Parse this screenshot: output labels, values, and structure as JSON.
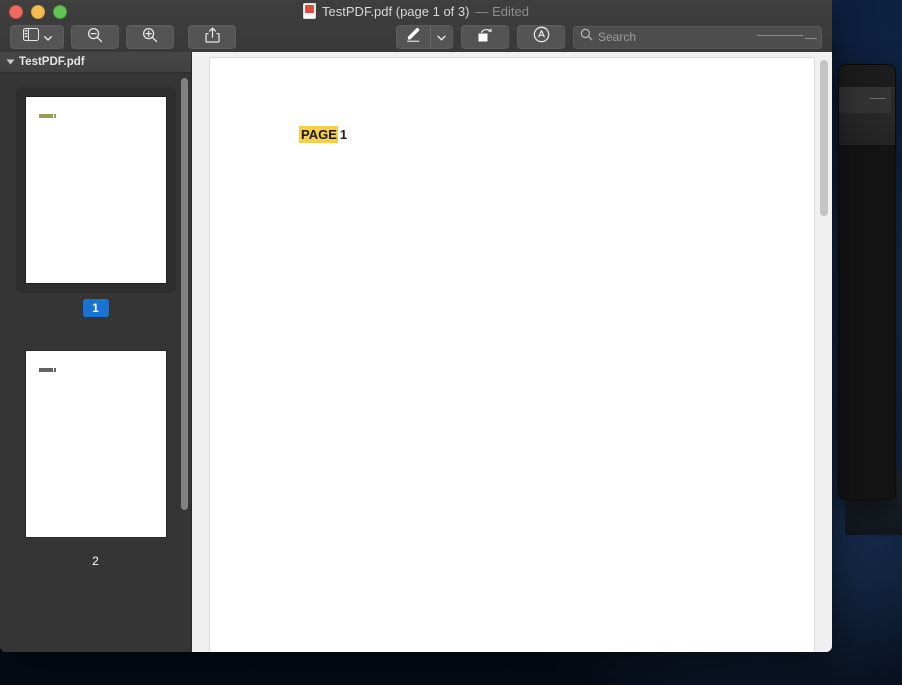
{
  "window": {
    "title_main": "TestPDF.pdf (page 1 of 3)",
    "title_sub": "— Edited",
    "doc_icon": "pdf-document-icon",
    "traffic_lights": {
      "close": "close-window-button",
      "minimize": "minimize-window-button",
      "maximize": "maximize-window-button"
    }
  },
  "toolbar": {
    "sidebar_toggle": "sidebar-toggle-icon",
    "sidebar_chevron": "chevron-down-icon",
    "zoom_out": "zoom-out-icon",
    "zoom_in": "zoom-in-icon",
    "share": "share-icon",
    "markup": "markup-pen-icon",
    "markup_chevron": "chevron-down-icon",
    "rotate": "rotate-icon",
    "annotate": "annotate-icon",
    "search_icon": "search-icon",
    "search_placeholder": "Search",
    "search_value": ""
  },
  "sidebar": {
    "header_title": "TestPDF.pdf",
    "disclosure": "disclosure-triangle-icon",
    "thumbnails": [
      {
        "label": "1",
        "selected": true
      },
      {
        "label": "2",
        "selected": false
      }
    ]
  },
  "document": {
    "highlighted_text": "PAGE",
    "page_number": "1"
  },
  "colors": {
    "accent": "#1873d3",
    "highlight": "#f7cd4c",
    "window_chrome": "#3a3a3a",
    "sidebar_bg": "#353535",
    "page_bg": "#ffffff",
    "desktop": "#0d2140"
  }
}
